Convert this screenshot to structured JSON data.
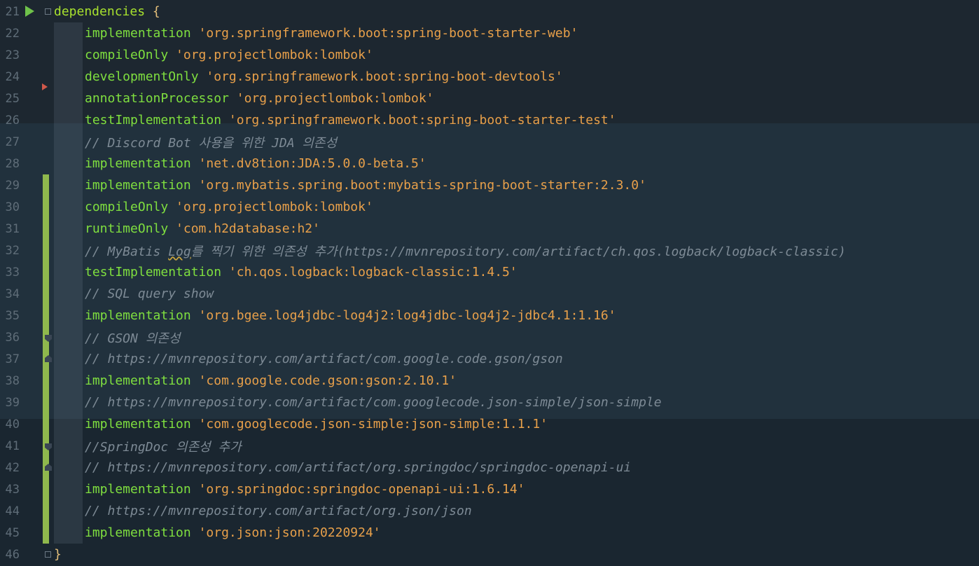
{
  "editor": {
    "lines": [
      {
        "num": "21",
        "parts": [
          {
            "t": "dependencies ",
            "c": "kw"
          },
          {
            "t": "{",
            "c": "brace"
          }
        ]
      },
      {
        "num": "22",
        "parts": [
          {
            "t": "implementation ",
            "c": "fn"
          },
          {
            "t": "'org.springframework.boot:spring-boot-starter-web'",
            "c": "str"
          }
        ]
      },
      {
        "num": "23",
        "parts": [
          {
            "t": "compileOnly ",
            "c": "fn"
          },
          {
            "t": "'org.projectlombok:lombok'",
            "c": "str"
          }
        ]
      },
      {
        "num": "24",
        "parts": [
          {
            "t": "developmentOnly ",
            "c": "fn"
          },
          {
            "t": "'org.springframework.boot:spring-boot-devtools'",
            "c": "str"
          }
        ]
      },
      {
        "num": "25",
        "parts": [
          {
            "t": "annotationProcessor ",
            "c": "fn"
          },
          {
            "t": "'org.projectlombok:lombok'",
            "c": "str"
          }
        ]
      },
      {
        "num": "26",
        "parts": [
          {
            "t": "testImplementation ",
            "c": "fn"
          },
          {
            "t": "'org.springframework.boot:spring-boot-starter-test'",
            "c": "str"
          }
        ]
      },
      {
        "num": "27",
        "parts": [
          {
            "t": "// Discord Bot 사용을 위한 JDA 의존성",
            "c": "cmt"
          }
        ]
      },
      {
        "num": "28",
        "parts": [
          {
            "t": "implementation ",
            "c": "fn"
          },
          {
            "t": "'net.dv8tion:JDA:5.0.0-beta.5'",
            "c": "str"
          }
        ]
      },
      {
        "num": "29",
        "parts": [
          {
            "t": "implementation ",
            "c": "fn"
          },
          {
            "t": "'org.mybatis.spring.boot:mybatis-spring-boot-starter:2.3.0'",
            "c": "str"
          }
        ]
      },
      {
        "num": "30",
        "parts": [
          {
            "t": "compileOnly ",
            "c": "fn"
          },
          {
            "t": "'org.projectlombok:lombok'",
            "c": "str"
          }
        ]
      },
      {
        "num": "31",
        "parts": [
          {
            "t": "runtimeOnly ",
            "c": "fn"
          },
          {
            "t": "'com.h2database:h2'",
            "c": "str"
          }
        ]
      },
      {
        "num": "32",
        "parts": [
          {
            "t": "// MyBatis ",
            "c": "cmt"
          },
          {
            "t": "Log",
            "c": "cmt sq"
          },
          {
            "t": "를 찍기 위한 의존성 추가(",
            "c": "cmt"
          },
          {
            "t": "https://mvnrepository.com/artifact/ch.qos.logback/logback-classic",
            "c": "cmt lk"
          },
          {
            "t": ")",
            "c": "cmt"
          }
        ]
      },
      {
        "num": "33",
        "parts": [
          {
            "t": "testImplementation ",
            "c": "fn"
          },
          {
            "t": "'ch.qos.logback:logback-classic:1.4.5'",
            "c": "str"
          }
        ]
      },
      {
        "num": "34",
        "parts": [
          {
            "t": "// SQL query show",
            "c": "cmt"
          }
        ]
      },
      {
        "num": "35",
        "parts": [
          {
            "t": "implementation ",
            "c": "fn"
          },
          {
            "t": "'org.bgee.log4jdbc-log4j2:log4jdbc-log4j2-jdbc4.1:1.16'",
            "c": "str"
          }
        ]
      },
      {
        "num": "36",
        "parts": [
          {
            "t": "// GSON 의존성",
            "c": "cmt"
          }
        ]
      },
      {
        "num": "37",
        "parts": [
          {
            "t": "// ",
            "c": "cmt"
          },
          {
            "t": "https://mvnrepository.com/artifact/com.google.code.gson/gson",
            "c": "cmt lk"
          }
        ]
      },
      {
        "num": "38",
        "parts": [
          {
            "t": "implementation ",
            "c": "fn"
          },
          {
            "t": "'com.google.code.gson:gson:2.10.1'",
            "c": "str"
          }
        ]
      },
      {
        "num": "39",
        "parts": [
          {
            "t": "// ",
            "c": "cmt"
          },
          {
            "t": "https://mvnrepository.com/artifact/com.googlecode.json-simple/json-simple",
            "c": "cmt lk"
          }
        ]
      },
      {
        "num": "40",
        "parts": [
          {
            "t": "implementation ",
            "c": "fn"
          },
          {
            "t": "'com.googlecode.json-simple:json-simple:1.1.1'",
            "c": "str"
          }
        ]
      },
      {
        "num": "41",
        "parts": [
          {
            "t": "//SpringDoc 의존성 추가",
            "c": "cmt"
          }
        ]
      },
      {
        "num": "42",
        "parts": [
          {
            "t": "// ",
            "c": "cmt"
          },
          {
            "t": "https://mvnrepository.com/artifact/org.springdoc/springdoc-openapi-ui",
            "c": "cmt lk"
          }
        ]
      },
      {
        "num": "43",
        "parts": [
          {
            "t": "implementation ",
            "c": "fn"
          },
          {
            "t": "'org.springdoc:springdoc-openapi-ui:1.6.14'",
            "c": "str"
          }
        ]
      },
      {
        "num": "44",
        "parts": [
          {
            "t": "// ",
            "c": "cmt"
          },
          {
            "t": "https://mvnrepository.com/artifact/org.json/json",
            "c": "cmt lk"
          }
        ]
      },
      {
        "num": "45",
        "parts": [
          {
            "t": "implementation ",
            "c": "fn"
          },
          {
            "t": "'org.json:json:20220924'",
            "c": "str"
          }
        ]
      },
      {
        "num": "46",
        "parts": [
          {
            "t": "}",
            "c": "brace"
          }
        ]
      }
    ]
  }
}
